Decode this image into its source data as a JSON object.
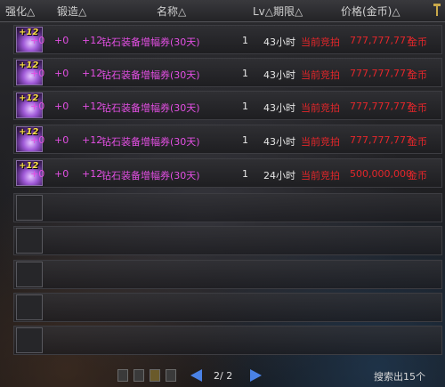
{
  "header": {
    "enhance": "强化△",
    "forge": "锻造△",
    "name": "名称△",
    "level_duration": "Lv△期限△",
    "price": "价格(金币)△"
  },
  "listings": [
    {
      "icon": "purple-costume-icon",
      "plus": "+12",
      "enhance": "+0",
      "forge": "+0",
      "refine": "+12",
      "name": "钻石装备增幅券(30天)",
      "lv": "1",
      "duration": "43小时",
      "bid_label": "当前竞拍",
      "price": "777,777,777",
      "currency": "金币"
    },
    {
      "icon": "purple-costume-icon",
      "plus": "+12",
      "enhance": "+0",
      "forge": "+0",
      "refine": "+12",
      "name": "钻石装备增幅券(30天)",
      "lv": "1",
      "duration": "43小时",
      "bid_label": "当前竞拍",
      "price": "777,777,777",
      "currency": "金币"
    },
    {
      "icon": "purple-costume-icon",
      "plus": "+12",
      "enhance": "+0",
      "forge": "+0",
      "refine": "+12",
      "name": "钻石装备增幅券(30天)",
      "lv": "1",
      "duration": "43小时",
      "bid_label": "当前竞拍",
      "price": "777,777,777",
      "currency": "金币"
    },
    {
      "icon": "purple-costume-icon",
      "plus": "+12",
      "enhance": "+0",
      "forge": "+0",
      "refine": "+12",
      "name": "钻石装备增幅券(30天)",
      "lv": "1",
      "duration": "43小时",
      "bid_label": "当前竞拍",
      "price": "777,777,777",
      "currency": "金币"
    },
    {
      "icon": "purple-costume-icon",
      "plus": "+12",
      "enhance": "+0",
      "forge": "+0",
      "refine": "+12",
      "name": "钻石装备增幅券(30天)",
      "lv": "1",
      "duration": "24小时",
      "bid_label": "当前竞拍",
      "price": "500,000,000",
      "currency": "金币"
    }
  ],
  "pager": {
    "text": "2/ 2"
  },
  "search_count": "搜索出15个",
  "colors": {
    "item_name": "#e34fe3",
    "price": "#e3262a",
    "pager_arrow": "#4a82e6"
  }
}
